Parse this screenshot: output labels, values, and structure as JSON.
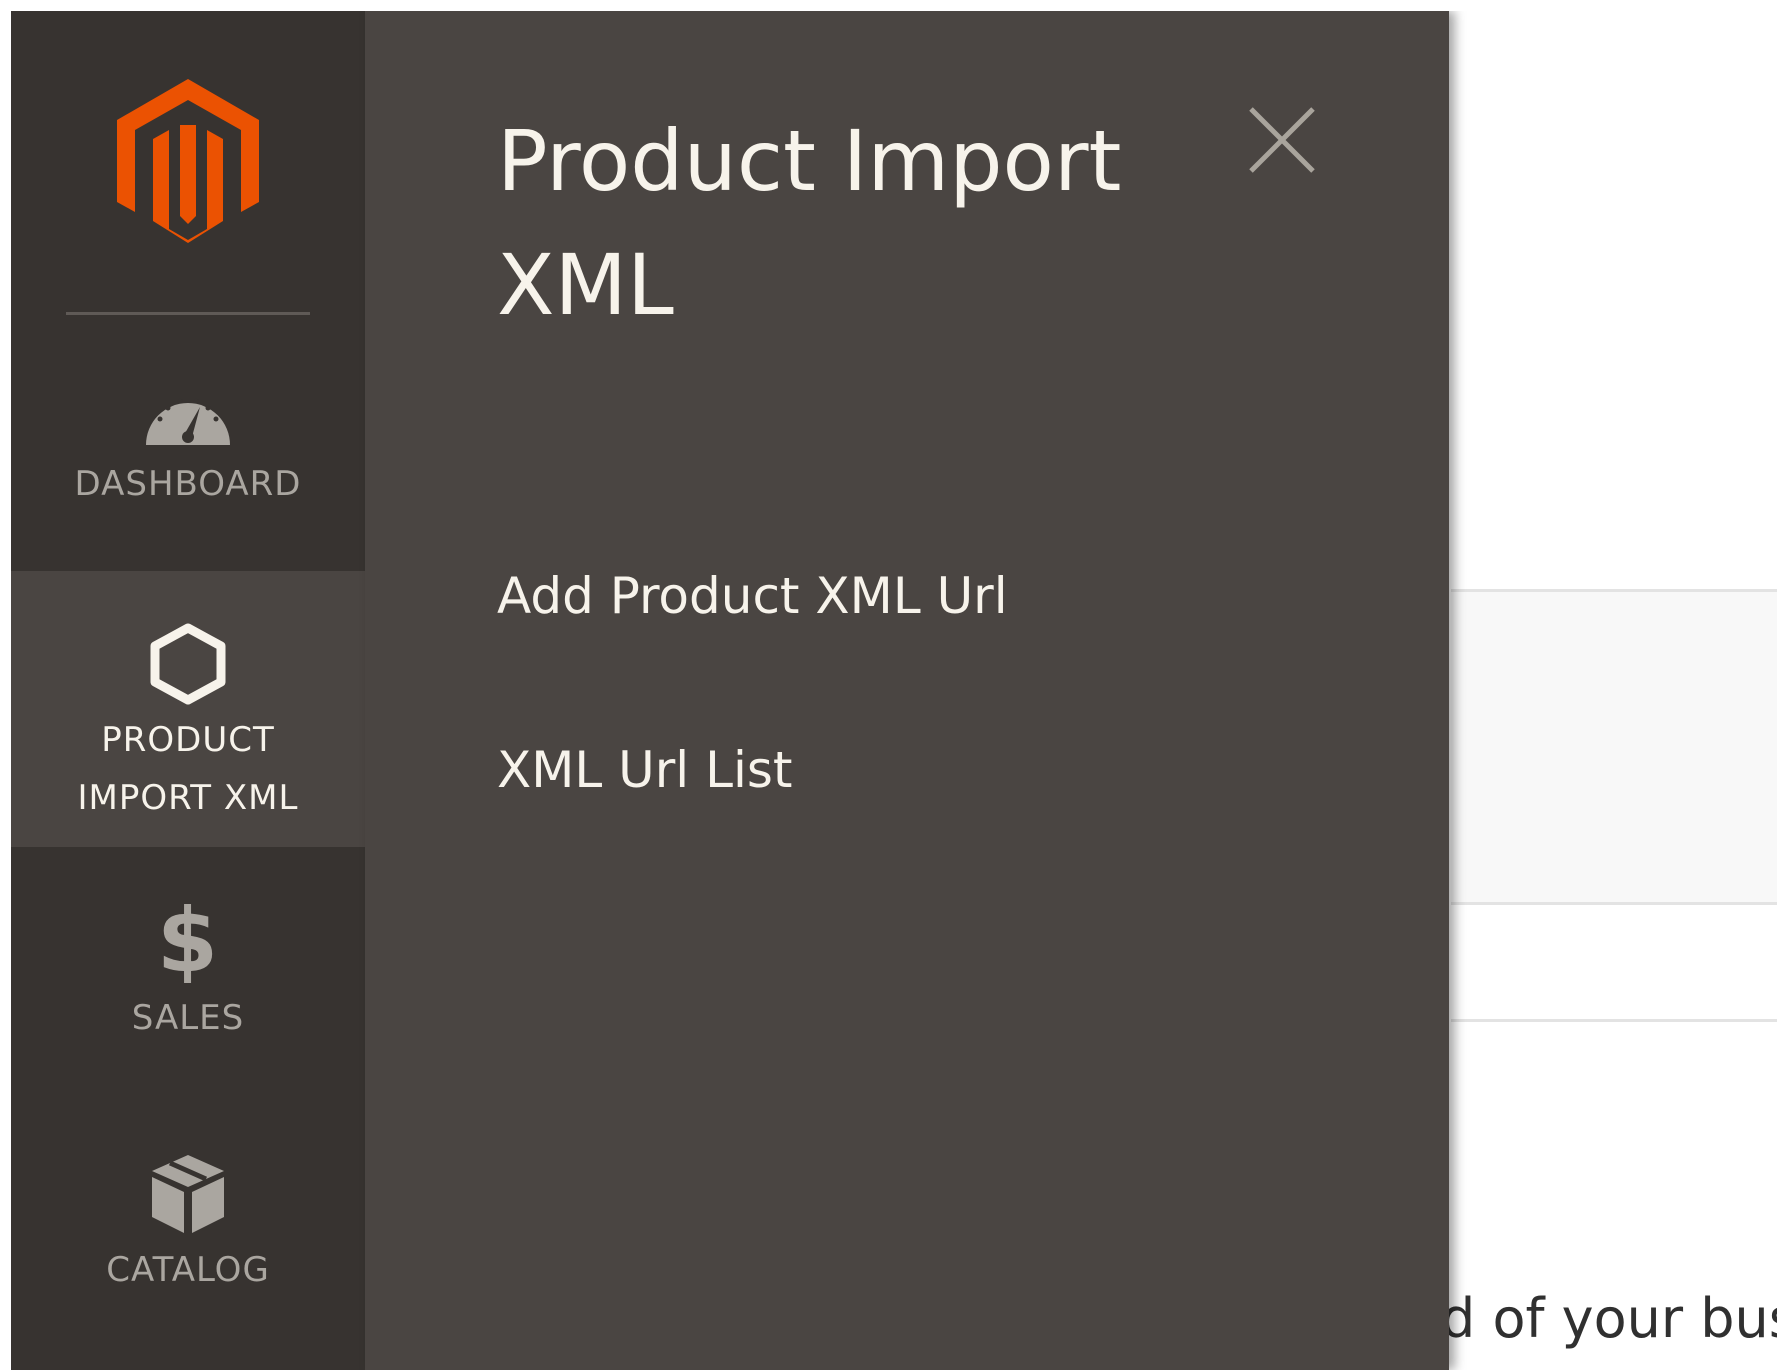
{
  "nav": {
    "items": [
      {
        "label": "DASHBOARD",
        "icon": "speedometer-icon"
      },
      {
        "label": "PRODUCT\nIMPORT XML",
        "icon": "hexagon-icon",
        "active": true
      },
      {
        "label": "SALES",
        "icon": "dollar-icon"
      },
      {
        "label": "CATALOG",
        "icon": "box-icon"
      }
    ],
    "product_line1": "PRODUCT",
    "product_line2": "IMPORT XML"
  },
  "flyout": {
    "title_line1": "Product Import",
    "title_line2": "XML",
    "links": [
      {
        "label": "Add Product XML Url"
      },
      {
        "label": "XML Url List"
      }
    ]
  },
  "background": {
    "partial_text": "d of your bus"
  },
  "colors": {
    "brand_orange": "#eb5202",
    "nav_bg": "#373330",
    "flyout_bg": "#4a4542",
    "text_light": "#f7f3eb",
    "text_muted": "#aaa6a0"
  }
}
